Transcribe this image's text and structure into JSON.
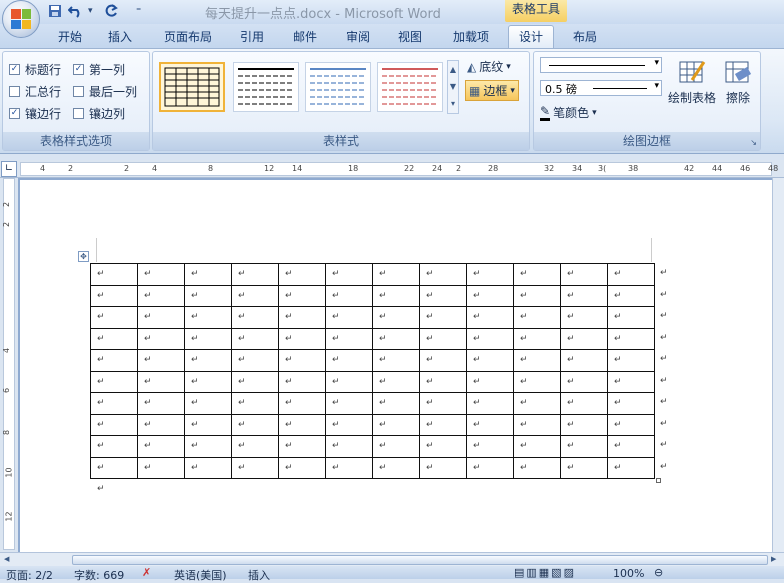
{
  "window": {
    "title": "每天提升一点点.docx - Microsoft Word",
    "contextual_tab_group": "表格工具"
  },
  "tabs": [
    {
      "label": "开始"
    },
    {
      "label": "插入"
    },
    {
      "label": "页面布局"
    },
    {
      "label": "引用"
    },
    {
      "label": "邮件"
    },
    {
      "label": "审阅"
    },
    {
      "label": "视图"
    },
    {
      "label": "加载项"
    },
    {
      "label": "设计",
      "active": true
    },
    {
      "label": "布局"
    }
  ],
  "ribbon": {
    "style_options": {
      "label": "表格样式选项",
      "options": [
        {
          "label": "标题行",
          "checked": true
        },
        {
          "label": "第一列",
          "checked": true
        },
        {
          "label": "汇总行",
          "checked": false
        },
        {
          "label": "最后一列",
          "checked": false
        },
        {
          "label": "镶边行",
          "checked": true
        },
        {
          "label": "镶边列",
          "checked": false
        }
      ]
    },
    "table_styles": {
      "label": "表样式",
      "shading": "底纹",
      "borders": "边框"
    },
    "draw_borders": {
      "label": "绘图边框",
      "line_weight": "0.5 磅",
      "pen_color": "笔颜色",
      "draw_table": "绘制表格",
      "eraser": "擦除"
    }
  },
  "ruler": {
    "h_numbers": [
      "4",
      "2",
      "2",
      "4",
      "8",
      "12",
      "14",
      "18",
      "22",
      "24",
      "2",
      "28",
      "32",
      "34",
      "3(",
      "38",
      "42",
      "44",
      "46",
      "48"
    ],
    "v_numbers": [
      "2",
      "2",
      "4",
      "6",
      "8",
      "10",
      "12"
    ]
  },
  "document": {
    "cell_mark": "↵",
    "rows": 10,
    "cols": 12
  },
  "status": {
    "page": "页面: 2/2",
    "words": "字数: 669",
    "language": "英语(美国)",
    "insert": "插入",
    "zoom": "100%"
  },
  "colors": {
    "accent": "#f5cf63",
    "ribbon_bg": "#dbe7f5",
    "tab_text": "#15396e"
  }
}
